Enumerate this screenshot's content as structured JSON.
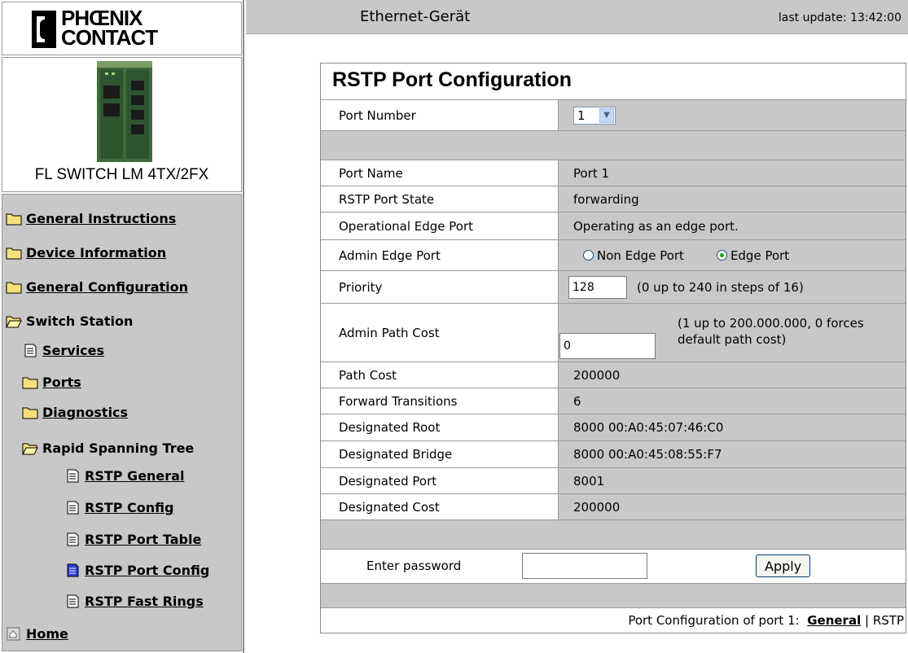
{
  "logo": {
    "line1": "PHŒNIX",
    "line2": "CONTACT"
  },
  "device": {
    "name": "FL SWITCH LM 4TX/2FX"
  },
  "nav": {
    "items": [
      {
        "label": "General Instructions",
        "icon": "folder-icon"
      },
      {
        "label": "Device Information",
        "icon": "folder-icon"
      },
      {
        "label": "General Configuration",
        "icon": "folder-icon"
      },
      {
        "label": "Switch Station",
        "icon": "folder-open-icon"
      },
      {
        "label": "Services",
        "icon": "page-icon"
      },
      {
        "label": "Ports",
        "icon": "folder-icon"
      },
      {
        "label": "Diagnostics",
        "icon": "folder-icon"
      },
      {
        "label": "Rapid Spanning Tree",
        "icon": "folder-open-icon"
      },
      {
        "label": "RSTP General",
        "icon": "page-icon"
      },
      {
        "label": "RSTP Config",
        "icon": "page-icon"
      },
      {
        "label": "RSTP Port Table",
        "icon": "page-icon"
      },
      {
        "label": "RSTP Port Config",
        "icon": "page-icon-active"
      },
      {
        "label": "RSTP Fast Rings",
        "icon": "page-icon"
      },
      {
        "label": "Home",
        "icon": "home-icon"
      }
    ]
  },
  "header": {
    "title": "Ethernet-Gerät",
    "last_update": "last update: 13:42:00"
  },
  "panel": {
    "title": "RSTP Port Configuration",
    "port_number_label": "Port Number",
    "port_number_value": "1",
    "rows": [
      {
        "label": "Port Name",
        "value": "Port 1"
      },
      {
        "label": "RSTP Port State",
        "value": "forwarding"
      },
      {
        "label": "Operational Edge Port",
        "value": "Operating as an edge port."
      }
    ],
    "admin_edge": {
      "label": "Admin Edge Port",
      "option_non_edge": "Non Edge Port",
      "option_edge": "Edge Port",
      "selected": "Edge Port"
    },
    "priority": {
      "label": "Priority",
      "value": "128",
      "hint": "(0 up to 240 in steps of 16)"
    },
    "admin_path_cost": {
      "label": "Admin Path Cost",
      "value": "0",
      "hint_line1": "(1 up to 200.000.000, 0 forces",
      "hint_line2": "default path cost)"
    },
    "rows2": [
      {
        "label": "Path Cost",
        "value": "200000"
      },
      {
        "label": "Forward Transitions",
        "value": "6"
      },
      {
        "label": "Designated Root",
        "value": "8000 00:A0:45:07:46:C0"
      },
      {
        "label": "Designated Bridge",
        "value": "8000 00:A0:45:08:55:F7"
      },
      {
        "label": "Designated Port",
        "value": "8001"
      },
      {
        "label": "Designated Cost",
        "value": "200000"
      }
    ],
    "password": {
      "label": "Enter password",
      "value": ""
    },
    "apply_label": "Apply",
    "footer": {
      "prefix": "Port Configuration of port 1:",
      "link_general": "General",
      "separator": "|",
      "link_rstp": "RSTP"
    }
  }
}
